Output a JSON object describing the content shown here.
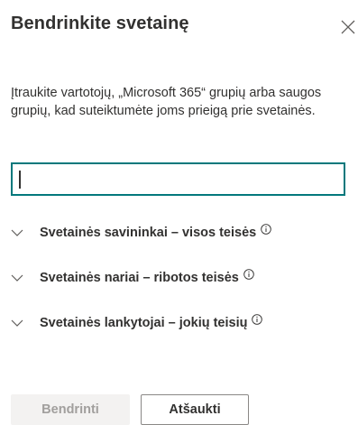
{
  "dialog": {
    "title": "Bendrinkite svetainę",
    "description": "Įtraukite vartotojų, „Microsoft 365“ grupių arba saugos grupių, kad suteiktumėte joms prieigą prie svetainės.",
    "search": {
      "value": "",
      "placeholder": ""
    },
    "accent_color": "#03787c",
    "permissions": [
      {
        "label": "Svetainės savininkai – visos teisės",
        "expanded": false,
        "icon": "chevron-down-icon"
      },
      {
        "label": "Svetainės nariai – ribotos teisės",
        "expanded": false,
        "icon": "chevron-down-icon"
      },
      {
        "label": "Svetainės lankytojai – jokių teisių",
        "expanded": false,
        "icon": "chevron-down-icon"
      }
    ],
    "buttons": {
      "share_label": "Bendrinti",
      "share_enabled": false,
      "cancel_label": "Atšaukti"
    },
    "close_icon": "close-icon"
  }
}
